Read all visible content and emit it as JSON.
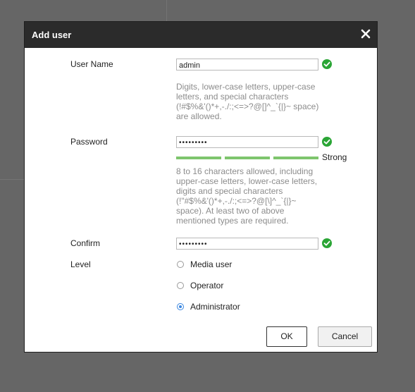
{
  "dialog": {
    "title": "Add user",
    "close_icon": "close-icon"
  },
  "user_name": {
    "label": "User Name",
    "value": "admin",
    "hint": "Digits, lower-case letters, upper-case letters, and special characters (!#$%&'()*+,-./:;<=>?@[]^_`{|}~ space) are allowed."
  },
  "password": {
    "label": "Password",
    "value": "•••••••••",
    "strength_label": "Strong",
    "strength_color": "#7ec56d",
    "hint": "8 to 16 characters allowed, including upper-case letters, lower-case letters, digits and special characters (!\"#$%&'()*+,-./:;<=>?@[\\]^_`{|}~ space). At least two of above mentioned types are required."
  },
  "confirm": {
    "label": "Confirm",
    "value": "•••••••••"
  },
  "level": {
    "label": "Level",
    "options": [
      {
        "label": "Media user",
        "selected": false
      },
      {
        "label": "Operator",
        "selected": false
      },
      {
        "label": "Administrator",
        "selected": true
      }
    ]
  },
  "buttons": {
    "ok": "OK",
    "cancel": "Cancel"
  },
  "colors": {
    "titlebar": "#2b2b2b",
    "valid": "#2aa535",
    "radio_accent": "#3a86e0"
  }
}
